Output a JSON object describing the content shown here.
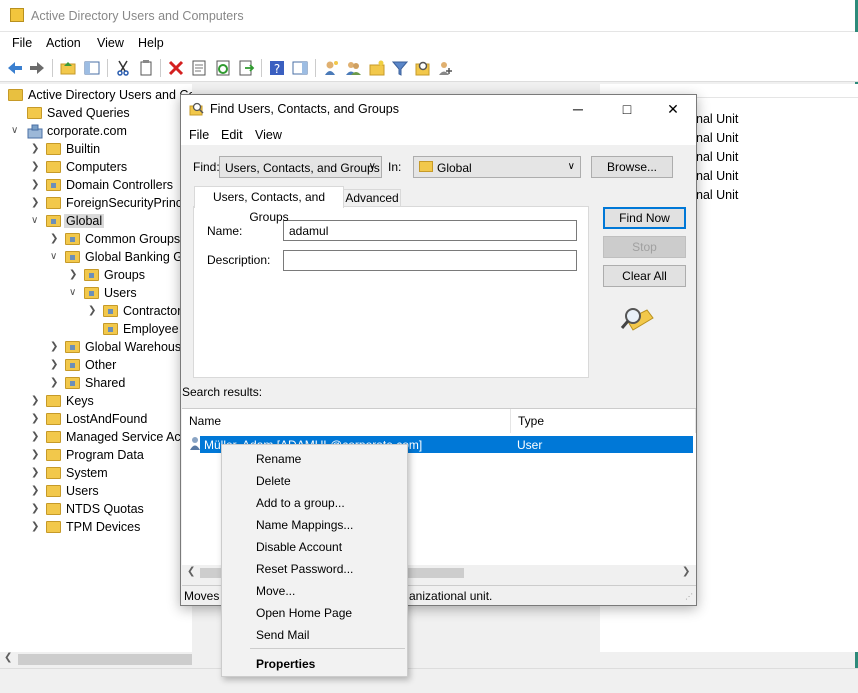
{
  "window": {
    "title": "Active Directory Users and Computers",
    "menu": [
      "File",
      "Action",
      "View",
      "Help"
    ]
  },
  "tree": {
    "root": "Active Directory Users and Computers [...]",
    "items": [
      {
        "label": "Saved Queries"
      },
      {
        "label": "corporate.com"
      },
      {
        "label": "Builtin"
      },
      {
        "label": "Computers"
      },
      {
        "label": "Domain Controllers"
      },
      {
        "label": "ForeignSecurityPrincip"
      },
      {
        "label": "Global"
      },
      {
        "label": "Common Groups"
      },
      {
        "label": "Global Banking Gr"
      },
      {
        "label": "Groups"
      },
      {
        "label": "Users"
      },
      {
        "label": "Contractor"
      },
      {
        "label": "Employee"
      },
      {
        "label": "Global Warehouse"
      },
      {
        "label": "Other"
      },
      {
        "label": "Shared"
      },
      {
        "label": "Keys"
      },
      {
        "label": "LostAndFound"
      },
      {
        "label": "Managed Service Acc"
      },
      {
        "label": "Program Data"
      },
      {
        "label": "System"
      },
      {
        "label": "Users"
      },
      {
        "label": "NTDS Quotas"
      },
      {
        "label": "TPM Devices"
      }
    ]
  },
  "right_pane": {
    "rows": [
      "nal Unit",
      "nal Unit",
      "nal Unit",
      "nal Unit",
      "nal Unit"
    ]
  },
  "dialog": {
    "title": "Find Users, Contacts, and Groups",
    "menu": [
      "File",
      "Edit",
      "View"
    ],
    "find_label": "Find:",
    "find_value": "Users, Contacts, and Groups",
    "in_label": "In:",
    "in_value": "Global",
    "browse_label": "Browse...",
    "tabs": [
      "Users, Contacts, and Groups",
      "Advanced"
    ],
    "name_label": "Name:",
    "name_value": "adamul",
    "description_label": "Description:",
    "description_value": "",
    "find_now_label": "Find Now",
    "stop_label": "Stop",
    "clear_all_label": "Clear All",
    "search_results_label": "Search results:",
    "columns": [
      "Name",
      "Type"
    ],
    "result": {
      "name": "Müller, Adam [ADAMUL@corporate.com]",
      "type": "User"
    },
    "status_left": "Moves",
    "status_right": "anizational unit."
  },
  "context_menu": {
    "items": [
      "Rename",
      "Delete",
      "Add to a group...",
      "Name Mappings...",
      "Disable Account",
      "Reset Password...",
      "Move...",
      "Open Home Page",
      "Send Mail"
    ],
    "default_item": "Properties"
  }
}
